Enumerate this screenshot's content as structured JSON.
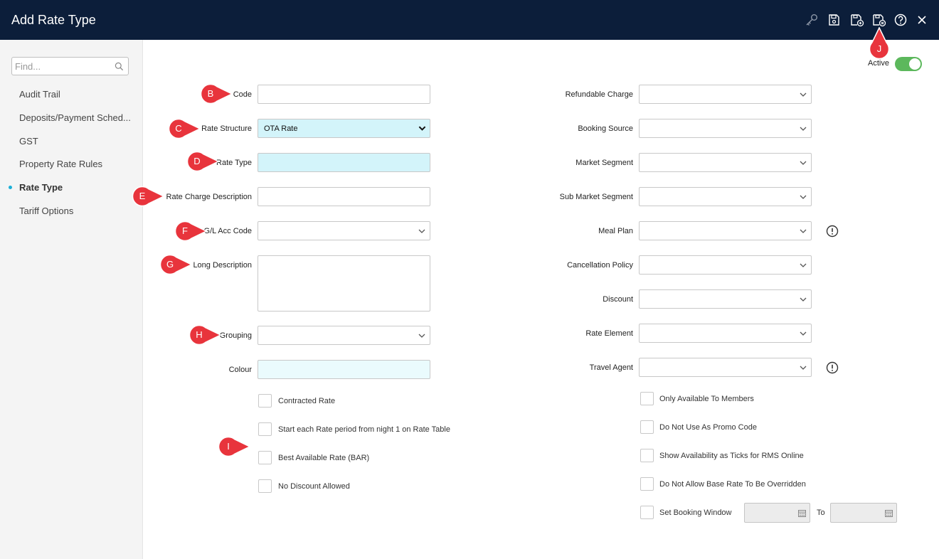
{
  "header": {
    "title": "Add Rate Type",
    "icons": [
      "key-icon",
      "save-icon",
      "save-and-new-icon",
      "save-and-close-icon",
      "help-icon",
      "close-icon"
    ]
  },
  "sidebar": {
    "search_placeholder": "Find...",
    "items": [
      {
        "label": "Audit Trail"
      },
      {
        "label": "Deposits/Payment Sched..."
      },
      {
        "label": "GST"
      },
      {
        "label": "Property Rate Rules"
      },
      {
        "label": "Rate Type",
        "active": true
      },
      {
        "label": "Tariff Options"
      }
    ]
  },
  "active_toggle": {
    "label": "Active",
    "on": true
  },
  "left_form": {
    "code": {
      "label": "Code",
      "value": ""
    },
    "rate_structure": {
      "label": "Rate Structure",
      "value": "OTA Rate"
    },
    "rate_type": {
      "label": "Rate Type",
      "value": ""
    },
    "rate_charge_description": {
      "label": "Rate Charge Description",
      "value": ""
    },
    "gl_acc_code": {
      "label": "G/L Acc Code",
      "value": ""
    },
    "long_description": {
      "label": "Long Description",
      "value": ""
    },
    "grouping": {
      "label": "Grouping",
      "value": ""
    },
    "colour": {
      "label": "Colour",
      "value": ""
    }
  },
  "left_checkboxes": [
    {
      "label": "Contracted Rate",
      "checked": false
    },
    {
      "label": "Start each Rate period from night 1 on Rate Table",
      "checked": false
    },
    {
      "label": "Best Available Rate (BAR)",
      "checked": false
    },
    {
      "label": "No Discount Allowed",
      "checked": false
    }
  ],
  "right_form": {
    "refundable_charge": {
      "label": "Refundable Charge",
      "value": ""
    },
    "booking_source": {
      "label": "Booking Source",
      "value": ""
    },
    "market_segment": {
      "label": "Market Segment",
      "value": ""
    },
    "sub_market_segment": {
      "label": "Sub Market Segment",
      "value": ""
    },
    "meal_plan": {
      "label": "Meal Plan",
      "value": ""
    },
    "cancellation_policy": {
      "label": "Cancellation Policy",
      "value": ""
    },
    "discount": {
      "label": "Discount",
      "value": ""
    },
    "rate_element": {
      "label": "Rate Element",
      "value": ""
    },
    "travel_agent": {
      "label": "Travel Agent",
      "value": ""
    }
  },
  "right_checkboxes": [
    {
      "label": "Only Available To Members",
      "checked": false
    },
    {
      "label": "Do Not Use As Promo Code",
      "checked": false
    },
    {
      "label": "Show Availability as Ticks for RMS Online",
      "checked": false
    },
    {
      "label": "Do Not Allow Base Rate To Be Overridden",
      "checked": false
    },
    {
      "label": "Set Booking Window",
      "checked": false
    }
  ],
  "booking_window": {
    "to_label": "To",
    "from_value": "",
    "to_value": ""
  },
  "markers": [
    "B",
    "C",
    "D",
    "E",
    "F",
    "G",
    "H",
    "I",
    "J"
  ],
  "colors": {
    "header_bg": "#0c1e3a",
    "cyan_field": "#d3f4fa",
    "marker_red": "#e8343c",
    "toggle_green": "#5cb85c",
    "nav_dot": "#1ab0d8"
  }
}
